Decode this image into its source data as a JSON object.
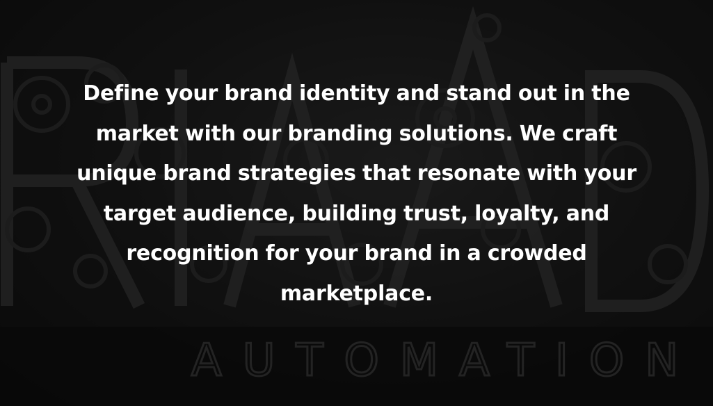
{
  "hero": {
    "description": "Define your brand identity and stand out in the market with our branding solutions. We craft unique brand strategies that resonate with your target audience, building trust, loyalty, and recognition for your brand in a crowded marketplace.",
    "background_image": "gear-built-letters-automation-artwork",
    "background_word": "AUTOMATION",
    "overlay_color": "#000000"
  }
}
